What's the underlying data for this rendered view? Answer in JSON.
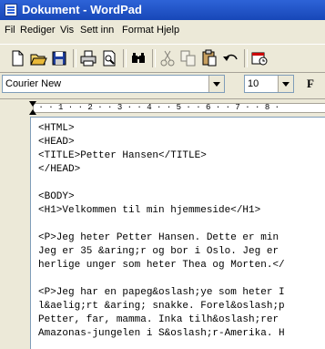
{
  "window": {
    "title": "Dokument - WordPad"
  },
  "menu": [
    "Fil",
    "Rediger",
    "Vis",
    "Sett inn",
    "Format",
    "Hjelp"
  ],
  "toolbar": {
    "buttons": [
      "new-icon",
      "open-icon",
      "save-icon",
      "print-icon",
      "print-preview-icon",
      "find-icon",
      "cut-icon",
      "copy-icon",
      "paste-icon",
      "undo-icon",
      "date-time-icon"
    ]
  },
  "format": {
    "font": "Courier New",
    "size": "10",
    "bold_label": "F"
  },
  "ruler": {
    "marks": " · · 1 · · 2 · · 3 · · 4 · · 5 · · 6 · · 7 · · 8 ·"
  },
  "document": {
    "lines": [
      "<HTML>",
      "<HEAD>",
      "<TITLE>Petter Hansen</TITLE>",
      "</HEAD>",
      "",
      "<BODY>",
      "<H1>Velkommen til min hjemmeside</H1>",
      "",
      "<P>Jeg heter Petter Hansen. Dette er min",
      "Jeg er 35 &aring;r og bor i Oslo. Jeg er",
      "herlige unger som heter Thea og Morten.</",
      "",
      "<P>Jeg har en papeg&oslash;ye som heter I",
      "l&aelig;rt &aring; snakke. Forel&oslash;p",
      "Petter, far, mamma. Inka tilh&oslash;rer",
      "Amazonas-jungelen i S&oslash;r-Amerika. H"
    ]
  }
}
